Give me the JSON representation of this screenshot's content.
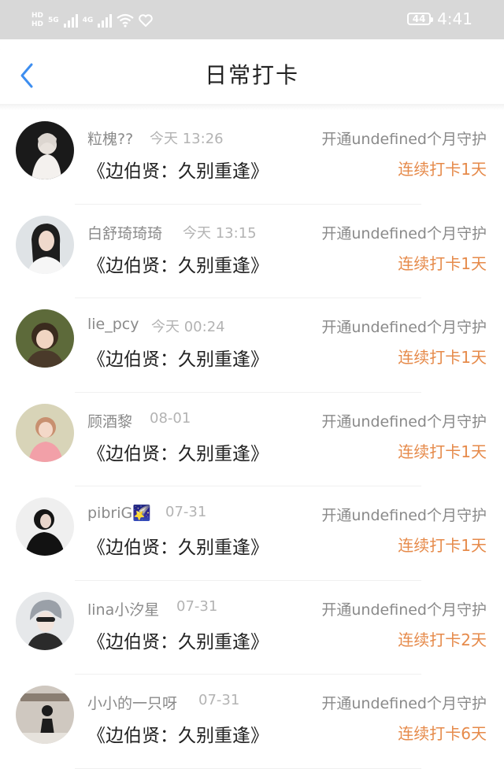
{
  "status_bar": {
    "net_top": "HD",
    "net_bottom": "HD",
    "sim1_type": "5G",
    "sim2_type": "4G",
    "battery": "44",
    "time": "4:41"
  },
  "header": {
    "title": "日常打卡",
    "back_icon": "chevron-left-icon"
  },
  "checkins": [
    {
      "user": "粒槐??",
      "time": "今天 13:26",
      "book": "《边伯贤：久别重逢》",
      "guard": "开通undefined个月守护",
      "streak": "连续打卡1天"
    },
    {
      "user": "白舒琦琦琦",
      "time": "今天 13:15",
      "book": "《边伯贤：久别重逢》",
      "guard": "开通undefined个月守护",
      "streak": "连续打卡1天"
    },
    {
      "user": "lie_pcy",
      "time": "今天 00:24",
      "book": "《边伯贤：久别重逢》",
      "guard": "开通undefined个月守护",
      "streak": "连续打卡1天"
    },
    {
      "user": "顾酒黎",
      "time": "08-01",
      "book": "《边伯贤：久别重逢》",
      "guard": "开通undefined个月守护",
      "streak": "连续打卡1天"
    },
    {
      "user": "pibriG🌠",
      "time": "07-31",
      "book": "《边伯贤：久别重逢》",
      "guard": "开通undefined个月守护",
      "streak": "连续打卡1天"
    },
    {
      "user": "lina小汐星",
      "time": "07-31",
      "book": "《边伯贤：久别重逢》",
      "guard": "开通undefined个月守护",
      "streak": "连续打卡2天"
    },
    {
      "user": "小小的一只呀",
      "time": "07-31",
      "book": "《边伯贤：久别重逢》",
      "guard": "开通undefined个月守护",
      "streak": "连续打卡6天"
    }
  ],
  "colors": {
    "accent_blue": "#3d8ef0",
    "streak_orange": "#e68a4a",
    "status_bar_bg": "#d8d8d8"
  }
}
